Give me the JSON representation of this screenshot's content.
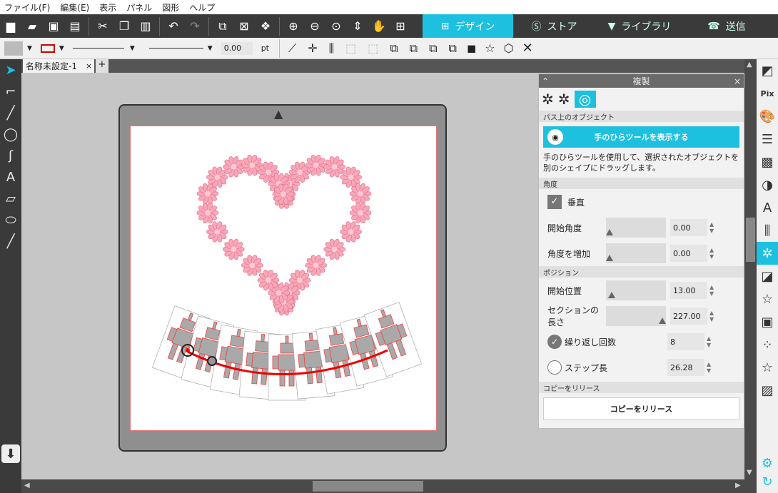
{
  "menu": [
    "ファイル(F)",
    "編集(E)",
    "表示",
    "パネル",
    "図形",
    "ヘルプ"
  ],
  "main_tabs": [
    {
      "label": "デザイン",
      "icon": "grid-icon"
    },
    {
      "label": "ストア",
      "icon": "store-icon"
    },
    {
      "label": "ライブラリ",
      "icon": "library-icon"
    },
    {
      "label": "送信",
      "icon": "send-icon"
    }
  ],
  "line_width": "0.00",
  "line_unit": "pt",
  "doc_tab": "名称未設定-1",
  "panel": {
    "title": "複製",
    "sec_path": "パス上のオブジェクト",
    "hand_button": "手のひらツールを表示する",
    "hint": "手のひらツールを使用して、選択されたオブジェクトを別のシェイプにドラッグします。",
    "sec_angle": "角度",
    "vertical": "垂直",
    "start_angle_label": "開始角度",
    "start_angle": "0.00",
    "angle_inc_label": "角度を増加",
    "angle_inc": "0.00",
    "sec_position": "ポジション",
    "start_pos_label": "開始位置",
    "start_pos": "13.00",
    "section_len_label": "セクションの長さ",
    "section_len": "227.00",
    "repeat_label": "繰り返し回数",
    "repeat": "8",
    "step_label": "ステップ長",
    "step": "26.28",
    "sec_release": "コピーをリリース",
    "release_button": "コピーをリリース"
  }
}
